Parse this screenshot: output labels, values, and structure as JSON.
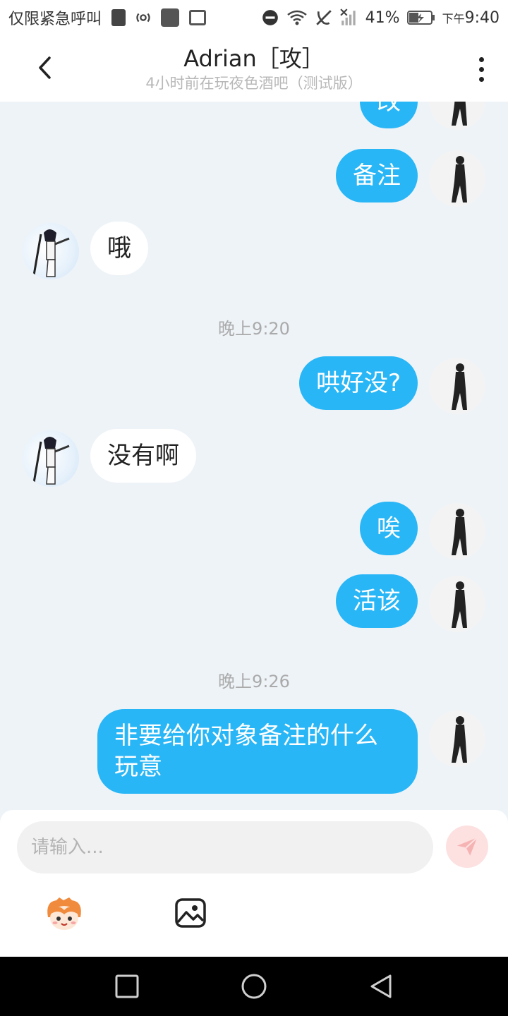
{
  "status_bar": {
    "carrier": "仅限紧急呼叫",
    "battery": "41%",
    "time_prefix": "下午",
    "time": "9:40"
  },
  "header": {
    "title": "Adrian［攻］",
    "subtitle": "4小时前在玩夜色酒吧（测试版）"
  },
  "messages": [
    {
      "from": "self",
      "text": "改"
    },
    {
      "from": "self",
      "text": "备注"
    },
    {
      "from": "other",
      "text": "哦"
    },
    {
      "type": "time",
      "text": "晚上9:20"
    },
    {
      "from": "self",
      "text": "哄好没?"
    },
    {
      "from": "other",
      "text": "没有啊"
    },
    {
      "from": "self",
      "text": "唉"
    },
    {
      "from": "self",
      "text": "活该"
    },
    {
      "type": "time",
      "text": "晚上9:26"
    },
    {
      "from": "self",
      "text": "非要给你对象备注的什么\n玩意"
    }
  ],
  "input": {
    "placeholder": "请输入..."
  },
  "icons": {
    "back": "chevron-left-icon",
    "more": "more-vertical-icon",
    "send": "paper-plane-icon",
    "emoji": "emoji-face-icon",
    "image": "image-icon",
    "nav_recent": "square-icon",
    "nav_home": "circle-icon",
    "nav_back": "triangle-back-icon"
  },
  "colors": {
    "self_bubble": "#29b6f6",
    "other_bubble": "#ffffff",
    "chat_background": "#eef3f8",
    "send_button_bg": "#fde1e1",
    "send_icon": "#f3a6a6"
  }
}
